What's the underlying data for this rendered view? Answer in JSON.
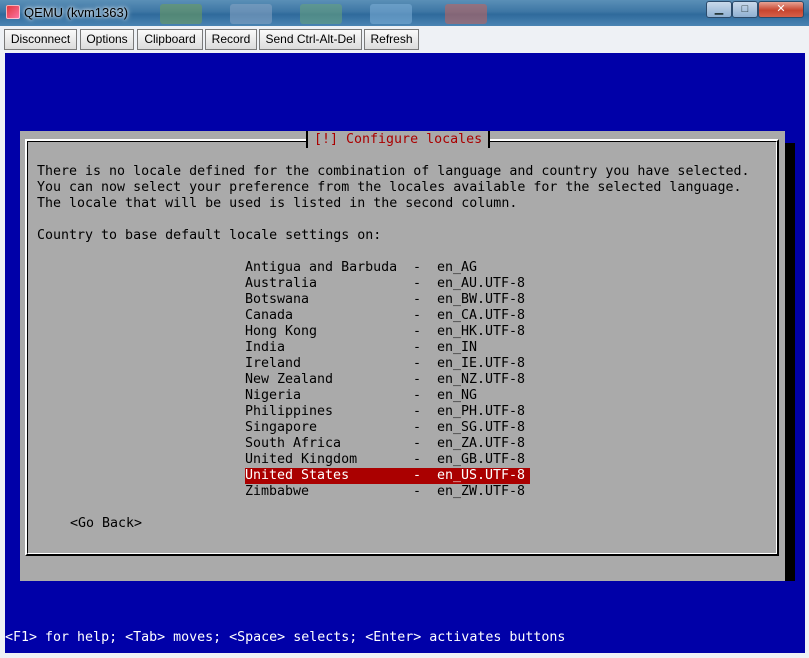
{
  "window": {
    "title": "QEMU (kvm1363)",
    "min_glyph": "▁",
    "max_glyph": "□",
    "close_glyph": "✕"
  },
  "toolbar": {
    "disconnect": "Disconnect",
    "options": "Options",
    "clipboard": "Clipboard",
    "record": "Record",
    "send_cad": "Send Ctrl-Alt-Del",
    "refresh": "Refresh"
  },
  "dialog": {
    "title": "[!] Configure locales",
    "intro": "There is no locale defined for the combination of language and country you have selected.\nYou can now select your preference from the locales available for the selected language.\nThe locale that will be used is listed in the second column.",
    "prompt": "Country to base default locale settings on:",
    "separator": "-",
    "options": [
      {
        "country": "Antigua and Barbuda",
        "locale": "en_AG"
      },
      {
        "country": "Australia",
        "locale": "en_AU.UTF-8"
      },
      {
        "country": "Botswana",
        "locale": "en_BW.UTF-8"
      },
      {
        "country": "Canada",
        "locale": "en_CA.UTF-8"
      },
      {
        "country": "Hong Kong",
        "locale": "en_HK.UTF-8"
      },
      {
        "country": "India",
        "locale": "en_IN"
      },
      {
        "country": "Ireland",
        "locale": "en_IE.UTF-8"
      },
      {
        "country": "New Zealand",
        "locale": "en_NZ.UTF-8"
      },
      {
        "country": "Nigeria",
        "locale": "en_NG"
      },
      {
        "country": "Philippines",
        "locale": "en_PH.UTF-8"
      },
      {
        "country": "Singapore",
        "locale": "en_SG.UTF-8"
      },
      {
        "country": "South Africa",
        "locale": "en_ZA.UTF-8"
      },
      {
        "country": "United Kingdom",
        "locale": "en_GB.UTF-8"
      },
      {
        "country": "United States",
        "locale": "en_US.UTF-8"
      },
      {
        "country": "Zimbabwe",
        "locale": "en_ZW.UTF-8"
      }
    ],
    "selected_index": 13,
    "go_back": "<Go Back>"
  },
  "status_line": "<F1> for help; <Tab> moves; <Space> selects; <Enter> activates buttons",
  "colors": {
    "screen_bg": "#0000a8",
    "dialog_bg": "#aaaaaa",
    "title_fg": "#aa0000",
    "selection_bg": "#aa0000"
  }
}
